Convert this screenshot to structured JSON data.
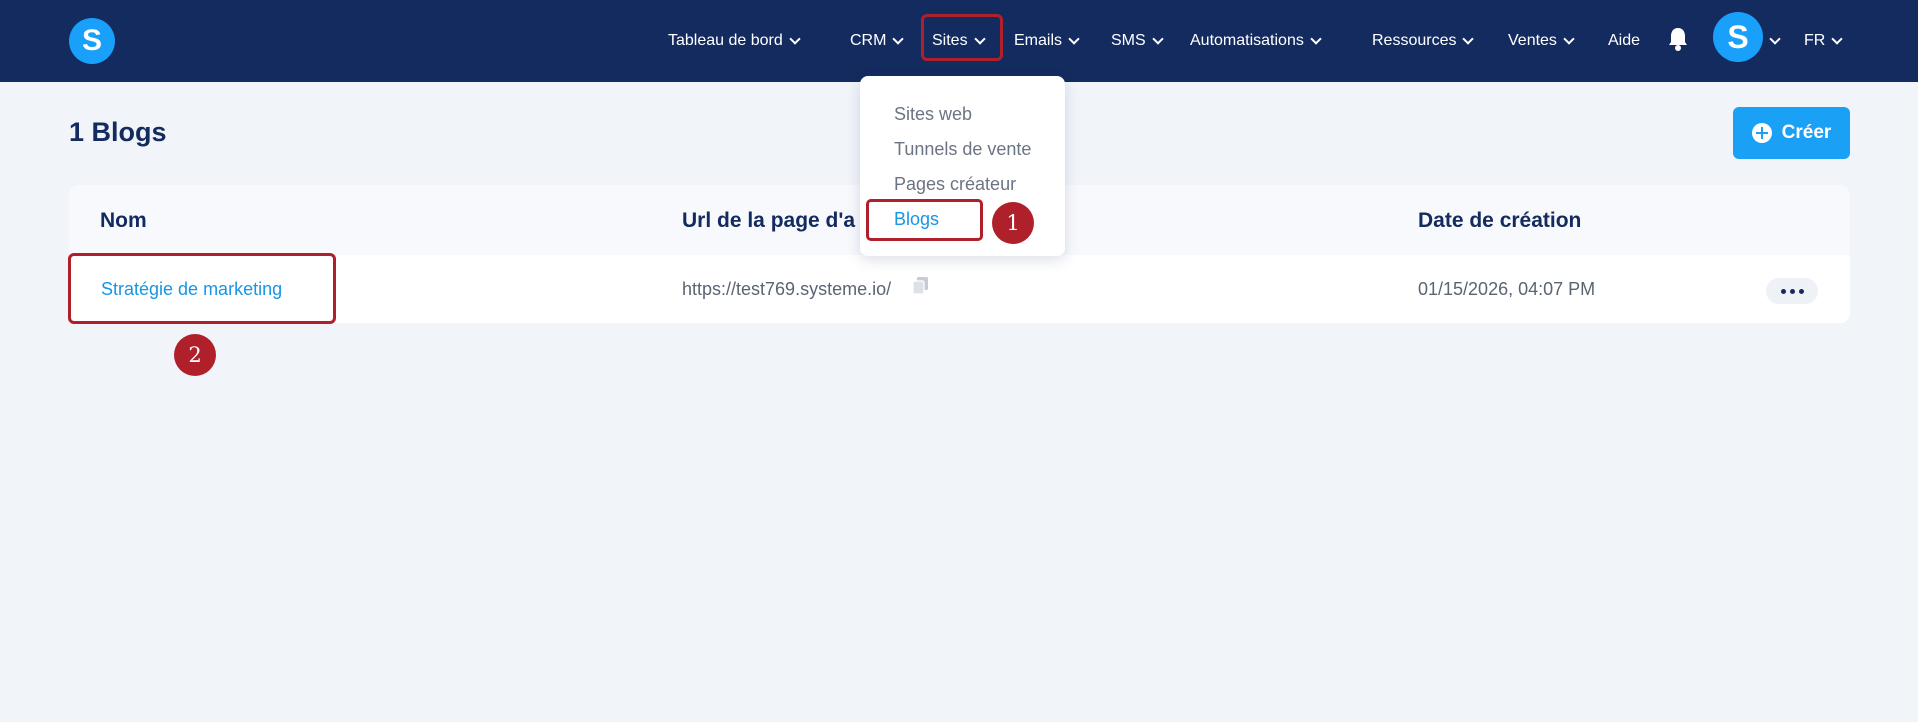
{
  "header": {
    "logo_letter": "S",
    "nav": [
      {
        "label": "Tableau de bord",
        "has_chevron": true
      },
      {
        "label": "CRM",
        "has_chevron": true
      },
      {
        "label": "Sites",
        "has_chevron": true
      },
      {
        "label": "Emails",
        "has_chevron": true
      },
      {
        "label": "SMS",
        "has_chevron": true
      },
      {
        "label": "Automatisations",
        "has_chevron": true
      },
      {
        "label": "Ressources",
        "has_chevron": true
      },
      {
        "label": "Ventes",
        "has_chevron": true
      },
      {
        "label": "Aide",
        "has_chevron": false
      }
    ],
    "bell_icon": "bell-icon",
    "avatar_letter": "S",
    "language": "FR"
  },
  "page": {
    "title": "1 Blogs",
    "create_label": "Créer"
  },
  "table": {
    "columns": [
      "Nom",
      "Url de la page d'a",
      "Date de création"
    ],
    "rows": [
      {
        "name": "Stratégie de marketing",
        "url": "https://test769.systeme.io/",
        "date": "01/15/2026, 04:07 PM"
      }
    ]
  },
  "dropdown": {
    "items": [
      {
        "label": "Sites web",
        "active": false
      },
      {
        "label": "Tunnels de vente",
        "active": false
      },
      {
        "label": "Pages créateur",
        "active": false
      },
      {
        "label": "Blogs",
        "active": true
      }
    ]
  },
  "annotations": {
    "step1": "1",
    "step2": "2"
  },
  "colors": {
    "header_bg": "#142b60",
    "accent": "#1aa0f5",
    "link": "#1795e6",
    "highlight": "#b0202a",
    "page_bg": "#f1f4f9"
  }
}
